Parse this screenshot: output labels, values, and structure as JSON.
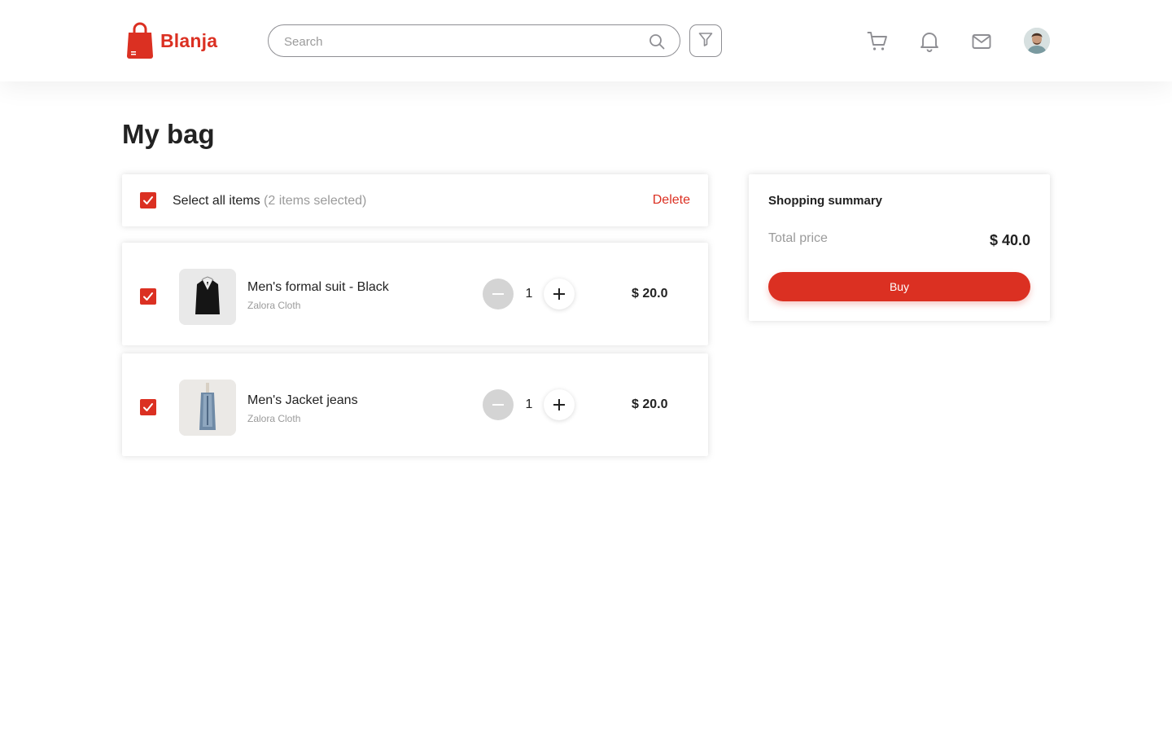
{
  "brand": {
    "name": "Blanja",
    "color": "#db3022"
  },
  "header": {
    "search_placeholder": "Search",
    "icons": [
      "search-icon",
      "filter-icon",
      "cart-icon",
      "bell-icon",
      "mail-icon",
      "avatar"
    ]
  },
  "page": {
    "title": "My bag"
  },
  "select_all": {
    "label": "Select all items",
    "count_text": "(2 items selected)",
    "checked": true,
    "delete_label": "Delete"
  },
  "items": [
    {
      "name": "Men's formal suit - Black",
      "brand": "Zalora Cloth",
      "quantity": "1",
      "price": "$ 20.0",
      "checked": true
    },
    {
      "name": "Men's Jacket jeans",
      "brand": "Zalora Cloth",
      "quantity": "1",
      "price": "$ 20.0",
      "checked": true
    }
  ],
  "summary": {
    "title": "Shopping summary",
    "total_label": "Total price",
    "total_value": "$ 40.0",
    "buy_label": "Buy"
  }
}
